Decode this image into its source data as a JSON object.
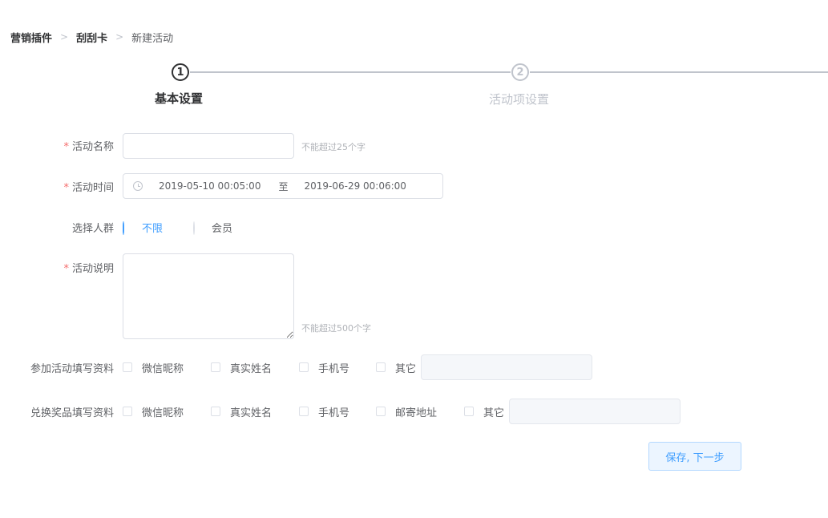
{
  "breadcrumb": {
    "items": [
      "营销插件",
      "刮刮卡",
      "新建活动"
    ],
    "separator": ">"
  },
  "steps": [
    {
      "number": "1",
      "title": "基本设置"
    },
    {
      "number": "2",
      "title": "活动项设置"
    }
  ],
  "form": {
    "name": {
      "label": "活动名称",
      "value": "",
      "hint": "不能超过25个字"
    },
    "time": {
      "label": "活动时间",
      "start": "2019-05-10 00:05:00",
      "separator": "至",
      "end": "2019-06-29 00:06:00"
    },
    "audience": {
      "label": "选择人群",
      "options": [
        "不限",
        "会员"
      ],
      "selected": "不限"
    },
    "description": {
      "label": "活动说明",
      "value": "",
      "hint": "不能超过500个字"
    },
    "join_info": {
      "label": "参加活动填写资料",
      "options": [
        "微信昵称",
        "真实姓名",
        "手机号",
        "其它"
      ]
    },
    "redeem_info": {
      "label": "兑换奖品填写资料",
      "options": [
        "微信昵称",
        "真实姓名",
        "手机号",
        "邮寄地址",
        "其它"
      ]
    },
    "required_mark": "*"
  },
  "actions": {
    "save_next": "保存, 下一步"
  },
  "colors": {
    "primary": "#409eff",
    "required": "#f56c6c",
    "text": "#606266",
    "muted": "#c0c4cc"
  }
}
